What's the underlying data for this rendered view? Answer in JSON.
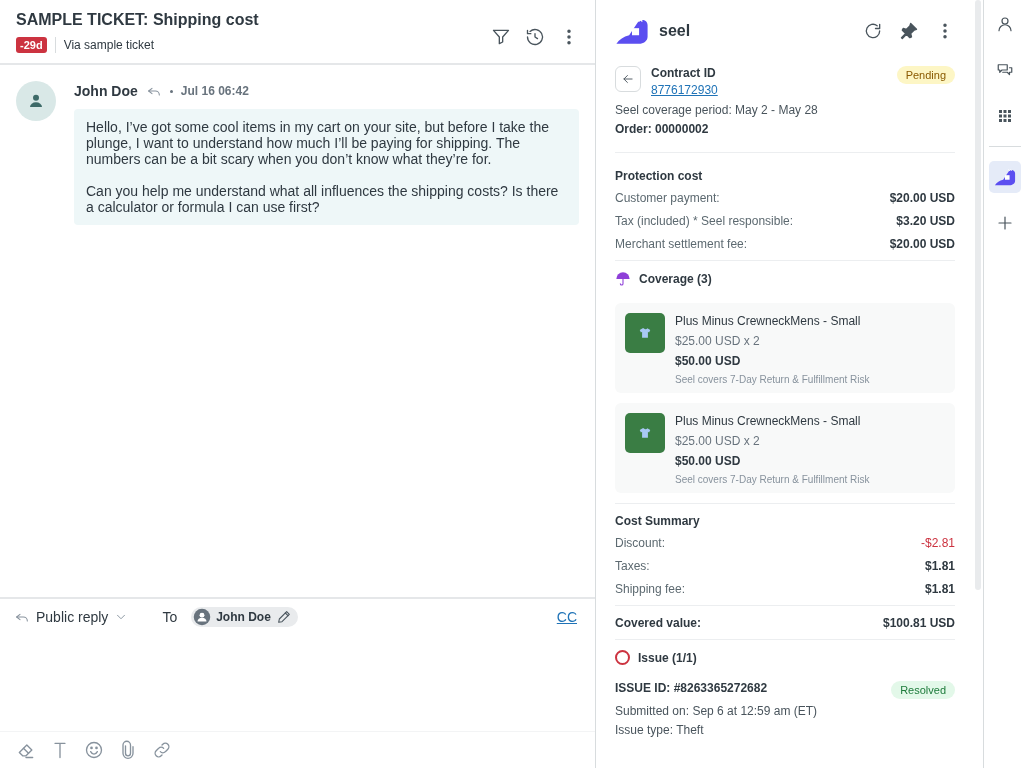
{
  "ticket": {
    "title": "SAMPLE TICKET: Shipping cost",
    "age_badge": "-29d",
    "channel": "Via sample ticket"
  },
  "message": {
    "author": "John Doe",
    "time": "Jul 16 06:42",
    "paragraphs": [
      "Hello, I’ve got some cool items in my cart on your site, but before I take the plunge, I want to understand how much I’ll be paying for shipping. The numbers can be a bit scary when you don’t know what they’re for.",
      "Can you help me understand what all influences the shipping costs? Is there a calculator or formula I can use first?"
    ]
  },
  "composer": {
    "mode": "Public reply",
    "to_label": "To",
    "recipient": "John Doe",
    "cc": "CC"
  },
  "app": {
    "name": "seel",
    "contract": {
      "label": "Contract ID",
      "id": "8776172930",
      "status": {
        "text": "Pending",
        "kind": "pending"
      },
      "period": "Seel coverage period: May 2 - May 28",
      "order": "Order: 00000002"
    },
    "protection": {
      "title": "Protection cost",
      "rows": [
        {
          "label": "Customer payment:",
          "value": "$20.00 USD",
          "kind": "normal"
        },
        {
          "label": "Tax (included) * Seel responsible:",
          "value": "$3.20 USD",
          "kind": "normal"
        },
        {
          "label": "Merchant settlement fee:",
          "value": "$20.00 USD",
          "kind": "normal"
        }
      ]
    },
    "coverage": {
      "title": "Coverage (3)",
      "items": [
        {
          "name": "Plus Minus CrewneckMens - Small",
          "unit": "$25.00 USD x 2",
          "total": "$50.00 USD",
          "note": "Seel covers 7-Day Return & Fulfillment Risk"
        },
        {
          "name": "Plus Minus CrewneckMens - Small",
          "unit": "$25.00 USD x 2",
          "total": "$50.00 USD",
          "note": "Seel covers 7-Day Return & Fulfillment Risk"
        }
      ]
    },
    "summary": {
      "title": "Cost Summary",
      "rows": [
        {
          "label": "Discount:",
          "value": "-$2.81",
          "kind": "negative"
        },
        {
          "label": "Taxes:",
          "value": "$1.81",
          "kind": "normal"
        },
        {
          "label": "Shipping fee:",
          "value": "$1.81",
          "kind": "normal"
        }
      ],
      "total_label": "Covered value:",
      "total_value": "$100.81 USD"
    },
    "issue": {
      "title": "Issue (1/1)",
      "id": "ISSUE ID: #8263365272682",
      "status": {
        "text": "Resolved",
        "kind": "resolved"
      },
      "lines": [
        "Submitted on: Sep 6 at 12:59 am (ET)",
        "Issue type: Theft"
      ]
    }
  },
  "rail": [
    {
      "kind": "person",
      "selected": false
    },
    {
      "kind": "chat",
      "selected": false
    },
    {
      "kind": "apps",
      "selected": false
    },
    {
      "kind": "seel",
      "selected": true
    },
    {
      "kind": "add",
      "selected": false
    }
  ]
}
